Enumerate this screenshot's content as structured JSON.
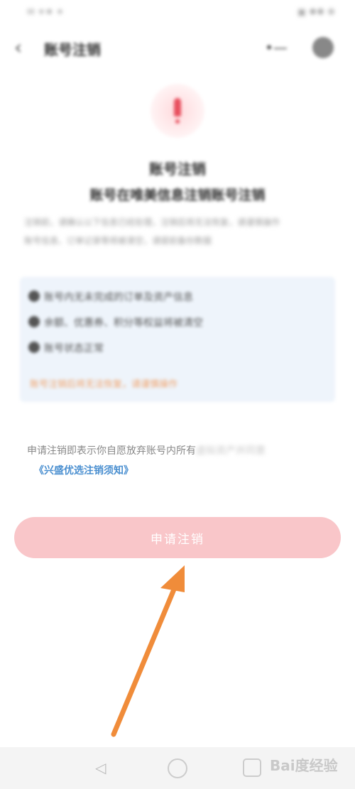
{
  "status_bar": {
    "left": "✉ ✶✷ ✶",
    "right": "▣ ✹✺ ✻"
  },
  "header": {
    "title": "账号注销"
  },
  "hero": {
    "title": "账号注销",
    "subtitle": "账号在唯美信息注销账号注销",
    "desc_line1": "注销前，请确认以下信息已经处理，注销后将无法恢复，请谨慎操作",
    "desc_line2": "账号信息、订单记录等将被清空，请提前备份数据"
  },
  "info_box": {
    "items": [
      "账号内无未完成的订单及资产信息",
      "余额、优惠券、积分等权益将被清空",
      "账号状态正常"
    ],
    "link": "账号注销后将无法恢复，请谨慎操作"
  },
  "agreement": {
    "line1_clear": "申请注销即表示你自愿放弃账号内所有",
    "line1_faded": "虚拟资产并同意",
    "link": "《兴盛优选注销须知》"
  },
  "apply_button": {
    "label": "申请注销"
  },
  "watermark": {
    "text": "Bai度经验"
  },
  "colors": {
    "button_bg": "#f9c6c9",
    "link_blue": "#4a8fd0",
    "info_bg": "#eef4fb",
    "warning_orange": "#f0a36c",
    "arrow_orange": "#f08c3a"
  }
}
